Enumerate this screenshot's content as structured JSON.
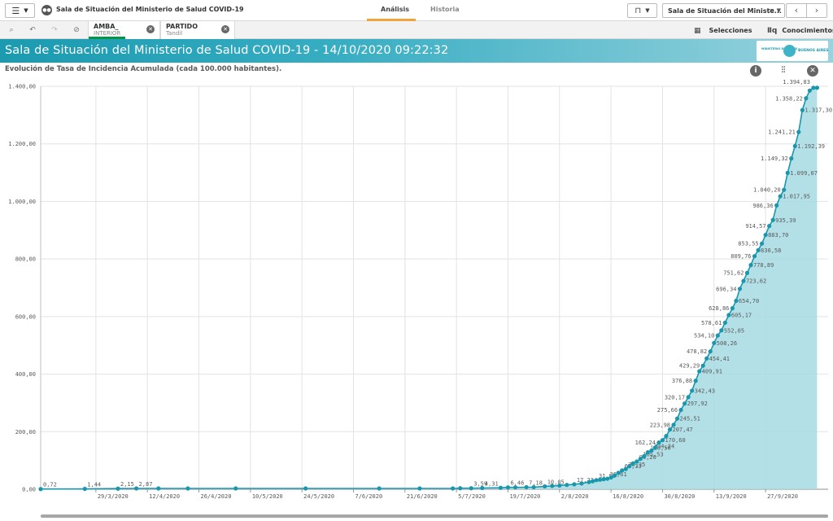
{
  "app": {
    "title": "Sala de Situación del Ministerio de Salud COVID-19",
    "tabs": [
      {
        "label": "Análisis",
        "active": true
      },
      {
        "label": "Historia",
        "active": false
      }
    ],
    "current_sheet": "Sala de Situación del Ministe..."
  },
  "selections": {
    "fields": [
      {
        "name": "AMBA_",
        "value": "INTERIOR"
      },
      {
        "name": "PARTIDO",
        "value": "Tandil"
      }
    ],
    "selecciones_label": "Selecciones",
    "conocimientos_label": "Conocimientos"
  },
  "banner": {
    "title": "Sala de Situación del Ministerio de Salud COVID-19 - 14/10/2020 09:22:32",
    "logo_ministry": "MINISTERIO DE SALUD",
    "logo_gob": "BUENOS AIRES"
  },
  "colors": {
    "accent": "#1b9ab0",
    "line": "#1a97ad",
    "area": "#a6dbe3",
    "selected_bar": "#009845",
    "tab_underline": "#f2a33a"
  },
  "chart_data": {
    "type": "area",
    "title": "Evolución de Tasa de Incidencia Acumulada (cada 100.000 habitantes).",
    "ylim": [
      0,
      1400
    ],
    "yticks": [
      "0,00",
      "200,00",
      "400,00",
      "600,00",
      "800,00",
      "1.000,00",
      "1.200,00",
      "1.400,00"
    ],
    "x_tick_labels": [
      "29/3/2020",
      "12/4/2020",
      "26/4/2020",
      "10/5/2020",
      "24/5/2020",
      "7/6/2020",
      "21/6/2020",
      "5/7/2020",
      "19/7/2020",
      "2/8/2020",
      "16/8/2020",
      "30/8/2020",
      "13/9/2020",
      "27/9/2020"
    ],
    "x_start": "14/3/2020",
    "x_end": "14/10/2020",
    "grid": true,
    "points": [
      {
        "x": "14/3/2020",
        "y": 0.72,
        "label": "0,72"
      },
      {
        "x": "26/3/2020",
        "y": 1.44,
        "label": "1,44"
      },
      {
        "x": "4/4/2020",
        "y": 2.15,
        "label": "2,15"
      },
      {
        "x": "9/4/2020",
        "y": 2.87,
        "label": "2,87"
      },
      {
        "x": "15/4/2020",
        "y": 2.87
      },
      {
        "x": "23/4/2020",
        "y": 2.87
      },
      {
        "x": "6/5/2020",
        "y": 2.87
      },
      {
        "x": "25/5/2020",
        "y": 2.87
      },
      {
        "x": "14/6/2020",
        "y": 2.87
      },
      {
        "x": "25/6/2020",
        "y": 2.87
      },
      {
        "x": "4/7/2020",
        "y": 2.87
      },
      {
        "x": "6/7/2020",
        "y": 3.59
      },
      {
        "x": "9/7/2020",
        "y": 3.59,
        "label": "3,59"
      },
      {
        "x": "12/7/2020",
        "y": 4.31,
        "label": "4,31"
      },
      {
        "x": "17/7/2020",
        "y": 5.02
      },
      {
        "x": "19/7/2020",
        "y": 6.46,
        "label": "6,46"
      },
      {
        "x": "21/7/2020",
        "y": 6.46
      },
      {
        "x": "24/7/2020",
        "y": 7.18,
        "label": "7,18"
      },
      {
        "x": "26/7/2020",
        "y": 7.18
      },
      {
        "x": "29/7/2020",
        "y": 10.05,
        "label": "10,05"
      },
      {
        "x": "31/7/2020",
        "y": 11.49
      },
      {
        "x": "2/8/2020",
        "y": 12.92
      },
      {
        "x": "4/8/2020",
        "y": 15.08
      },
      {
        "x": "6/8/2020",
        "y": 17.23,
        "label": "17,23"
      },
      {
        "x": "8/8/2020",
        "y": 20.1
      },
      {
        "x": "10/8/2020",
        "y": 25.13
      },
      {
        "x": "11/8/2020",
        "y": 28.0
      },
      {
        "x": "12/8/2020",
        "y": 31.59,
        "label": "31,59"
      },
      {
        "x": "13/8/2020",
        "y": 33.0
      },
      {
        "x": "14/8/2020",
        "y": 35.0
      },
      {
        "x": "15/8/2020",
        "y": 36.61,
        "label": "36,61"
      },
      {
        "x": "16/8/2020",
        "y": 41.0
      },
      {
        "x": "17/8/2020",
        "y": 48.0
      },
      {
        "x": "18/8/2020",
        "y": 57.0
      },
      {
        "x": "19/8/2020",
        "y": 65.33,
        "label": "65,33"
      },
      {
        "x": "20/8/2020",
        "y": 70.35,
        "label": "70,35"
      },
      {
        "x": "21/8/2020",
        "y": 80.0
      },
      {
        "x": "22/8/2020",
        "y": 90.0
      },
      {
        "x": "23/8/2020",
        "y": 96.2,
        "label": "96,20"
      },
      {
        "x": "24/8/2020",
        "y": 105.53,
        "label": "105,53"
      },
      {
        "x": "25/8/2020",
        "y": 115.0
      },
      {
        "x": "26/8/2020",
        "y": 128.5,
        "label": "128,50"
      },
      {
        "x": "27/8/2020",
        "y": 134.24,
        "label": "134,24"
      },
      {
        "x": "28/8/2020",
        "y": 145.0
      },
      {
        "x": "29/8/2020",
        "y": 162.24,
        "label": "162,24"
      },
      {
        "x": "30/8/2020",
        "y": 170.6,
        "label": "170,60"
      },
      {
        "x": "31/8/2020",
        "y": 185.0
      },
      {
        "x": "1/9/2020",
        "y": 207.47,
        "label": "207,47"
      },
      {
        "x": "2/9/2020",
        "y": 223.98,
        "label": "223,98"
      },
      {
        "x": "3/9/2020",
        "y": 245.51,
        "label": "245,51"
      },
      {
        "x": "4/9/2020",
        "y": 275.66,
        "label": "275,66"
      },
      {
        "x": "5/9/2020",
        "y": 297.92,
        "label": "297,92"
      },
      {
        "x": "6/9/2020",
        "y": 320.17,
        "label": "320,17"
      },
      {
        "x": "7/9/2020",
        "y": 342.43,
        "label": "342,43"
      },
      {
        "x": "8/9/2020",
        "y": 376.88,
        "label": "376,88"
      },
      {
        "x": "9/9/2020",
        "y": 409.91,
        "label": "409,91"
      },
      {
        "x": "10/9/2020",
        "y": 429.29,
        "label": "429,29"
      },
      {
        "x": "11/9/2020",
        "y": 454.41,
        "label": "454,41"
      },
      {
        "x": "12/9/2020",
        "y": 478.82,
        "label": "478,82"
      },
      {
        "x": "13/9/2020",
        "y": 508.26,
        "label": "508,26"
      },
      {
        "x": "14/9/2020",
        "y": 534.1,
        "label": "534,10"
      },
      {
        "x": "15/9/2020",
        "y": 552.05,
        "label": "552,05"
      },
      {
        "x": "16/9/2020",
        "y": 578.61,
        "label": "578,61"
      },
      {
        "x": "17/9/2020",
        "y": 605.17,
        "label": "605,17"
      },
      {
        "x": "18/9/2020",
        "y": 628.86,
        "label": "628,86"
      },
      {
        "x": "19/9/2020",
        "y": 654.7,
        "label": "654,70"
      },
      {
        "x": "20/9/2020",
        "y": 696.34,
        "label": "696,34"
      },
      {
        "x": "21/9/2020",
        "y": 723.62,
        "label": "723,62"
      },
      {
        "x": "22/9/2020",
        "y": 751.62,
        "label": "751,62"
      },
      {
        "x": "23/9/2020",
        "y": 778.89,
        "label": "778,89"
      },
      {
        "x": "24/9/2020",
        "y": 809.76,
        "label": "809,76"
      },
      {
        "x": "25/9/2020",
        "y": 830.58,
        "label": "830,58"
      },
      {
        "x": "26/9/2020",
        "y": 853.55,
        "label": "853,55"
      },
      {
        "x": "27/9/2020",
        "y": 883.7,
        "label": "883,70"
      },
      {
        "x": "28/9/2020",
        "y": 914.57,
        "label": "914,57"
      },
      {
        "x": "29/9/2020",
        "y": 935.39,
        "label": "935,39"
      },
      {
        "x": "30/9/2020",
        "y": 986.36,
        "label": "986,36"
      },
      {
        "x": "1/10/2020",
        "y": 1017.95,
        "label": "1.017,95"
      },
      {
        "x": "2/10/2020",
        "y": 1040.2,
        "label": "1.040,20"
      },
      {
        "x": "3/10/2020",
        "y": 1099.07,
        "label": "1.099,07"
      },
      {
        "x": "4/10/2020",
        "y": 1149.32,
        "label": "1.149,32"
      },
      {
        "x": "5/10/2020",
        "y": 1192.39,
        "label": "1.192,39"
      },
      {
        "x": "6/10/2020",
        "y": 1241.21,
        "label": "1.241,21"
      },
      {
        "x": "7/10/2020",
        "y": 1317.3,
        "label": "1.317,30"
      },
      {
        "x": "8/10/2020",
        "y": 1358.22,
        "label": "1.358,22"
      },
      {
        "x": "9/10/2020",
        "y": 1385.0
      },
      {
        "x": "10/10/2020",
        "y": 1394.83,
        "label": "1.394,83"
      },
      {
        "x": "11/10/2020",
        "y": 1394.83
      }
    ]
  }
}
